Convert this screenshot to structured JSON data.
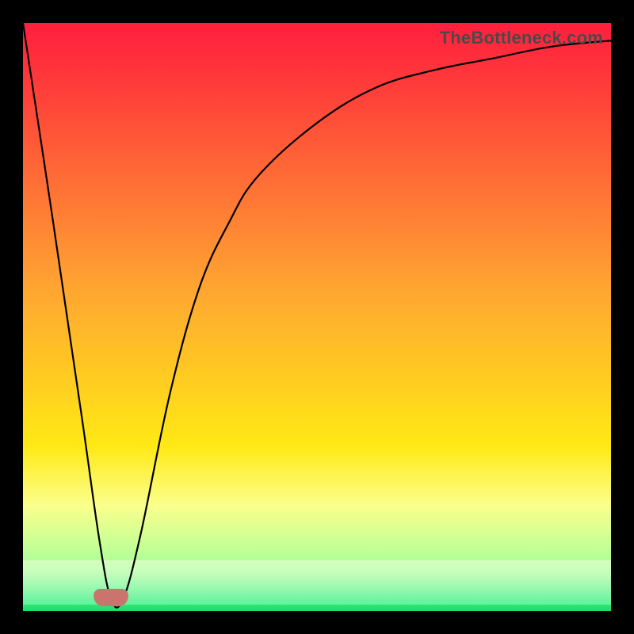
{
  "watermark": "TheBottleneck.com",
  "colors": {
    "top": "#ff1f3e",
    "red": "#ff3a3a",
    "orange": "#ffa531",
    "yellow": "#ffe915",
    "paleyellow": "#fbff8c",
    "lightgreen": "#a6ff9a",
    "green": "#19e06a",
    "bump": "#cb746e"
  },
  "chart_data": {
    "type": "line",
    "title": "",
    "xlabel": "",
    "ylabel": "",
    "xlim": [
      0,
      100
    ],
    "ylim": [
      0,
      100
    ],
    "series": [
      {
        "name": "curve",
        "x": [
          0,
          5,
          10,
          13,
          15,
          17,
          20,
          25,
          30,
          35,
          40,
          50,
          60,
          70,
          80,
          90,
          100
        ],
        "y": [
          100,
          67,
          33,
          12,
          2,
          2,
          13,
          37,
          55,
          66,
          74,
          83,
          89,
          92,
          94,
          96,
          97
        ]
      }
    ],
    "annotations": [
      {
        "type": "bump",
        "x": 15,
        "y": 1
      }
    ]
  }
}
